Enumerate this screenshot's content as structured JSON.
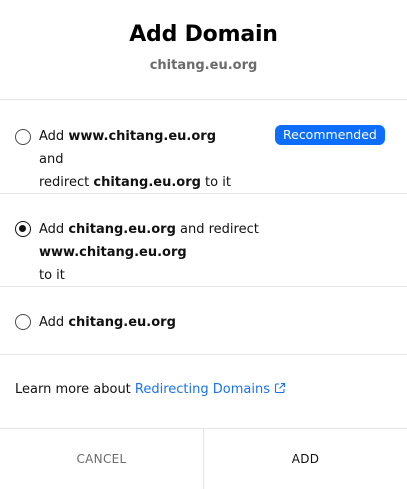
{
  "dialog": {
    "title": "Add Domain",
    "domain": "chitang.eu.org"
  },
  "options": [
    {
      "text_add": "Add ",
      "www_domain": "www.chitang.eu.org",
      "text_and": " and",
      "text_redirect": "redirect ",
      "domain": "chitang.eu.org",
      "text_to_it": " to it",
      "badge": "Recommended",
      "selected": false
    },
    {
      "text_add": "Add ",
      "domain": "chitang.eu.org",
      "text_and_redirect": " and redirect ",
      "www_domain": "www.chitang.eu.org",
      "text_to_it": "to it",
      "selected": true
    },
    {
      "text_add": "Add ",
      "domain": "chitang.eu.org",
      "selected": false
    }
  ],
  "learn_more": {
    "prefix": "Learn more about ",
    "link": "Redirecting Domains",
    "icon": "external-link-icon"
  },
  "footer": {
    "cancel_label": "CANCEL",
    "add_label": "ADD"
  },
  "colors": {
    "accent": "#0d6efd",
    "link": "#1a73e8",
    "muted": "#6b6b6b"
  }
}
